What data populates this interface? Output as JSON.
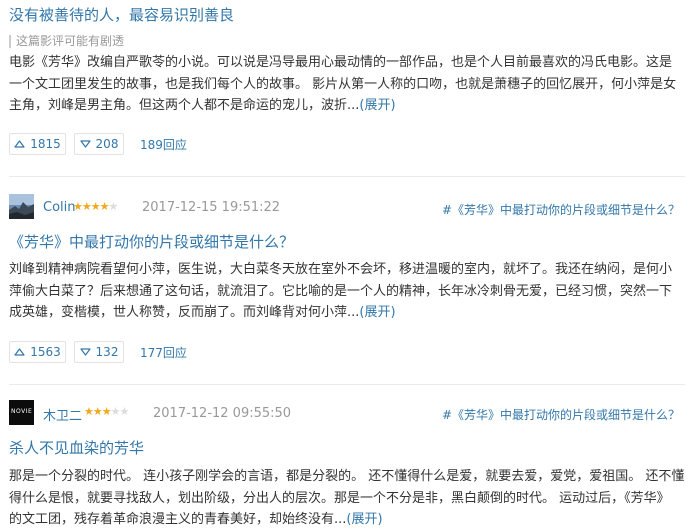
{
  "reviews": [
    {
      "title": "没有被善待的人，最容易识别善良",
      "spoiler": "这篇影评可能有剧透",
      "lines": [
        "电影《芳华》改编自严歌苓的小说。可以说是冯导最用心最动情的一部作品，也是个人目前最喜欢的冯氏电影。这是",
        "一个文工团里发生的故事，也是我们每个人的故事。 影片从第一人称的口吻，也就是萧穗子的回忆展开，何小萍是女",
        "主角，刘峰是男主角。但这两个人都不是命运的宠儿，波折..."
      ],
      "expand": "(展开)",
      "useful": "1815",
      "useless": "208",
      "replies": "189回应"
    },
    {
      "user": "Colin",
      "rating": 4,
      "time": "2017-12-15 19:51:22",
      "topic": "#《芳华》中最打动你的片段或细节是什么？",
      "title": "《芳华》中最打动你的片段或细节是什么？",
      "lines": [
        "刘峰到精神病院看望何小萍，医生说，大白菜冬天放在室外不会坏，移进温暖的室内，就坏了。我还在纳闷，是何小",
        "萍偷大白菜了？后来想通了这句话，就流泪了。它比喻的是一个人的精神，长年冰冷刺骨无爱，已经习惯，突然一下",
        "成英雄，变楷模，世人称赞，反而崩了。而刘峰背对何小萍..."
      ],
      "expand": "(展开)",
      "useful": "1563",
      "useless": "132",
      "replies": "177回应"
    },
    {
      "user": "木卫二",
      "avatar_text": "NOVIE",
      "rating": 3,
      "time": "2017-12-12 09:55:50",
      "topic": "#《芳华》中最打动你的片段或细节是什么？",
      "title": "杀人不见血染的芳华",
      "lines": [
        "那是一个分裂的时代。 连小孩子刚学会的言语，都是分裂的。 还不懂得什么是爱，就要去爱，爱党，爱祖国。 还不懂",
        "得什么是恨，就要寻找敌人，划出阶级，分出人的层次。那是一个不分是非，黑白颠倒的时代。 运动过后，《芳华》",
        "的文工团，残存着革命浪漫主义的青春美好，却始终没有..."
      ],
      "expand": "(展开)"
    }
  ],
  "icons": {
    "up": "thumb-up-arrow",
    "down": "thumb-down-arrow"
  },
  "colors": {
    "link": "#3377aa",
    "star": "#f0a81e",
    "meta": "#999999"
  }
}
